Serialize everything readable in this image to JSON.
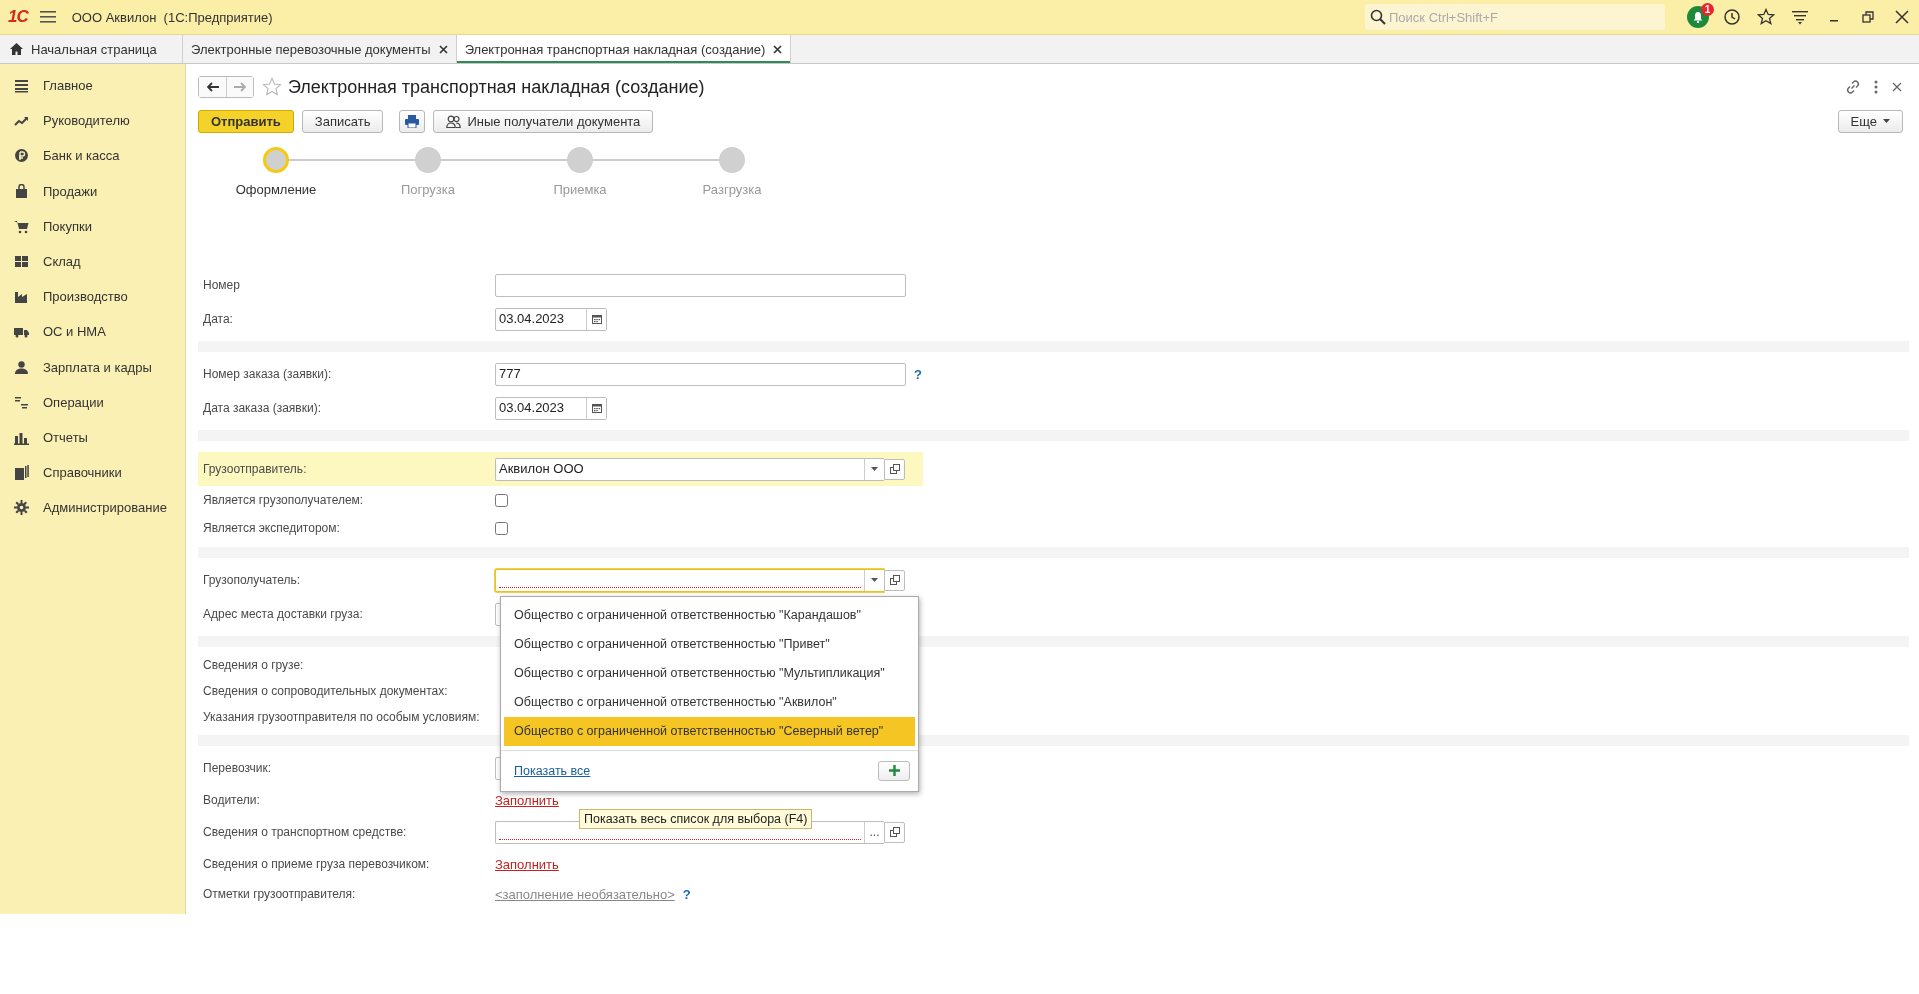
{
  "app": {
    "logo": "1С",
    "title": "ООО Аквилон  (1С:Предприятие)",
    "search_placeholder": "Поиск Ctrl+Shift+F",
    "notifications": "1"
  },
  "tabs": [
    {
      "label": "Начальная страница",
      "kind": "home",
      "selected": false
    },
    {
      "label": "Электронные перевозочные документы",
      "kind": "doc",
      "selected": false
    },
    {
      "label": "Электронная транспортная накладная (создание)",
      "kind": "doc",
      "selected": true
    }
  ],
  "sidebar": {
    "items": [
      {
        "label": "Главное"
      },
      {
        "label": "Руководителю"
      },
      {
        "label": "Банк и касса"
      },
      {
        "label": "Продажи"
      },
      {
        "label": "Покупки"
      },
      {
        "label": "Склад"
      },
      {
        "label": "Производство"
      },
      {
        "label": "ОС и НМА"
      },
      {
        "label": "Зарплата и кадры"
      },
      {
        "label": "Операции"
      },
      {
        "label": "Отчеты"
      },
      {
        "label": "Справочники"
      },
      {
        "label": "Администрирование"
      }
    ]
  },
  "form": {
    "title": "Электронная транспортная накладная (создание)",
    "more_button": "Еще",
    "buttons": [
      {
        "kind": "primary",
        "label": "Отправить"
      },
      {
        "kind": "plain",
        "label": "Записать"
      },
      {
        "kind": "print"
      },
      {
        "kind": "recipients",
        "label": "Иные получатели документа"
      }
    ],
    "steps": [
      {
        "label": "Оформление",
        "selected": true
      },
      {
        "label": "Погрузка",
        "selected": false
      },
      {
        "label": "Приемка",
        "selected": false
      },
      {
        "label": "Разгрузка",
        "selected": false
      }
    ],
    "sections": [
      {
        "rows": [
          {
            "kind": "text",
            "label": "Номер"
          },
          {
            "kind": "date",
            "label": "Дата:",
            "value": "03.04.2023"
          }
        ]
      },
      {
        "rows": [
          {
            "kind": "text",
            "label": "Номер заказа (заявки):",
            "value": "777",
            "help": "?"
          },
          {
            "kind": "date",
            "label": "Дата заказа (заявки):",
            "value": "03.04.2023"
          }
        ]
      },
      {
        "rows": [
          {
            "kind": "choice",
            "label": "Грузоотправитель:",
            "value": "Аквилон ООО",
            "highlighted": true
          },
          {
            "kind": "checkbox",
            "label": "Является грузополучателем:",
            "checked": false
          },
          {
            "kind": "checkbox",
            "label": "Является экспедитором:",
            "checked": false
          }
        ]
      },
      {
        "rows": [
          {
            "kind": "choice",
            "label": "Грузополучатель:",
            "focused": true,
            "required": true,
            "dropdown": {
              "items": [
                {
                  "label": "Общество с ограниченной ответственностью \"Карандашов\"",
                  "selected": false
                },
                {
                  "label": "Общество с ограниченной ответственностью \"Привет\"",
                  "selected": false
                },
                {
                  "label": "Общество с ограниченной ответственностью \"Мультипликация\"",
                  "selected": false
                },
                {
                  "label": "Общество с ограниченной ответственностью \"Аквилон\"",
                  "selected": false
                },
                {
                  "label": "Общество с ограниченной ответственностью \"Северный ветер\"",
                  "selected": true
                }
              ],
              "show_all": "Показать все",
              "tooltip": "Показать весь список для выбора (F4)"
            }
          },
          {
            "kind": "covered",
            "label": "Адрес места доставки груза:"
          }
        ]
      },
      {
        "rows": [
          {
            "kind": "label",
            "label": "Сведения о грузе:"
          },
          {
            "kind": "label",
            "label": "Сведения о сопроводительных документах:"
          },
          {
            "kind": "label",
            "label": "Указания грузоотправителя по особым условиям:"
          }
        ]
      },
      {
        "rows": [
          {
            "kind": "covered",
            "label": "Перевозчик:"
          },
          {
            "kind": "link",
            "label": "Водители:",
            "value": "Заполнить",
            "required": true
          },
          {
            "kind": "ref",
            "label": "Сведения о транспортном средстве:",
            "required": true,
            "button": "..."
          },
          {
            "kind": "link",
            "label": "Сведения о приеме груза перевозчиком:",
            "value": "Заполнить",
            "required": true
          },
          {
            "kind": "link",
            "label": "Отметки грузоотправителя:",
            "value": "<заполнение необязательно>",
            "required": false,
            "help": "?"
          }
        ]
      }
    ]
  }
}
